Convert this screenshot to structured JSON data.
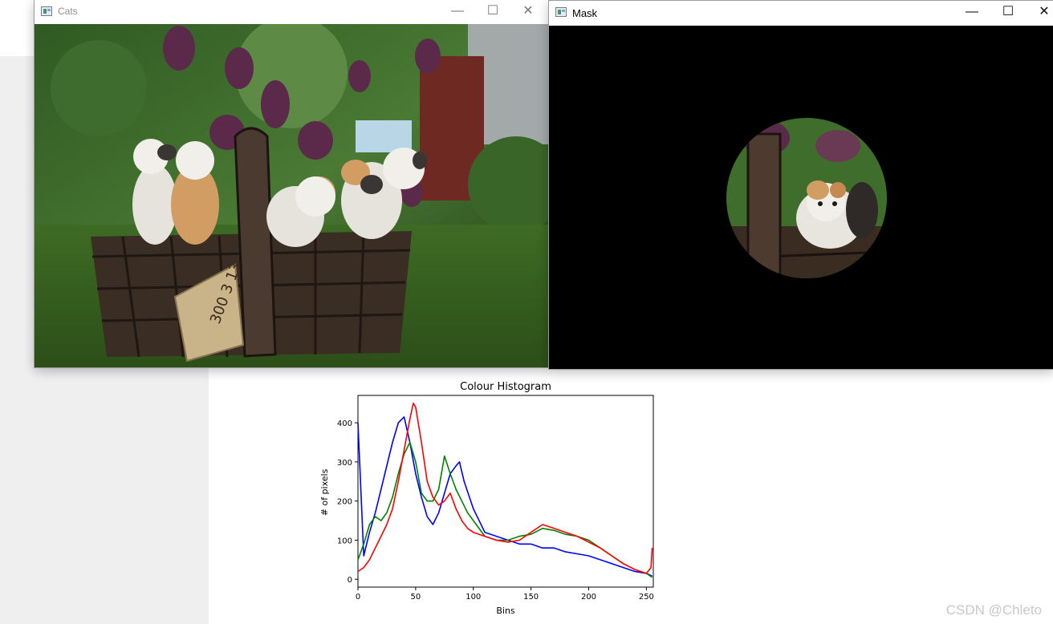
{
  "cats_window": {
    "title": "Cats",
    "controls": {
      "minimize": "—",
      "maximize": "☐",
      "close": "✕"
    },
    "tag_text": "300 3 13"
  },
  "mask_window": {
    "title": "Mask",
    "controls": {
      "minimize": "—",
      "maximize": "☐",
      "close": "✕"
    }
  },
  "watermark": "CSDN @Chleto",
  "colors": {
    "blue": "#0000ff",
    "green": "#008000",
    "red": "#ff0000",
    "mask_bg": "#000000"
  },
  "chart_data": {
    "type": "line",
    "title": "Colour Histogram",
    "xlabel": "Bins",
    "ylabel": "# of pixels",
    "xlim": [
      0,
      256
    ],
    "ylim": [
      -20,
      470
    ],
    "xticks": [
      "0",
      "50",
      "100",
      "150",
      "200",
      "250"
    ],
    "yticks": [
      "0",
      "100",
      "200",
      "300",
      "400"
    ],
    "grid": false,
    "series": [
      {
        "color": "blue",
        "x": [
          0,
          5,
          10,
          15,
          20,
          25,
          30,
          35,
          40,
          45,
          50,
          55,
          60,
          65,
          70,
          75,
          80,
          85,
          88,
          92,
          100,
          110,
          120,
          130,
          140,
          150,
          160,
          170,
          180,
          190,
          200,
          210,
          220,
          230,
          240,
          250,
          255
        ],
        "y": [
          400,
          60,
          120,
          170,
          230,
          290,
          350,
          400,
          415,
          350,
          270,
          210,
          160,
          140,
          170,
          220,
          270,
          290,
          300,
          250,
          180,
          120,
          110,
          100,
          90,
          90,
          80,
          80,
          70,
          65,
          60,
          50,
          40,
          30,
          20,
          15,
          8
        ]
      },
      {
        "color": "green",
        "x": [
          0,
          5,
          10,
          15,
          20,
          25,
          30,
          35,
          40,
          45,
          50,
          55,
          60,
          65,
          70,
          75,
          80,
          85,
          90,
          95,
          100,
          110,
          120,
          130,
          140,
          150,
          160,
          170,
          180,
          190,
          200,
          210,
          220,
          230,
          240,
          250,
          255
        ],
        "y": [
          50,
          90,
          140,
          160,
          150,
          170,
          210,
          270,
          320,
          350,
          300,
          220,
          200,
          200,
          230,
          315,
          270,
          230,
          200,
          170,
          150,
          110,
          100,
          100,
          110,
          115,
          130,
          125,
          115,
          110,
          100,
          80,
          60,
          40,
          25,
          15,
          5
        ]
      },
      {
        "color": "red",
        "x": [
          0,
          5,
          10,
          15,
          20,
          25,
          30,
          35,
          40,
          45,
          48,
          50,
          55,
          60,
          65,
          70,
          75,
          80,
          85,
          90,
          95,
          100,
          110,
          120,
          130,
          140,
          150,
          160,
          170,
          180,
          190,
          200,
          210,
          220,
          230,
          240,
          250,
          254,
          255
        ],
        "y": [
          20,
          30,
          50,
          80,
          110,
          140,
          180,
          250,
          330,
          410,
          450,
          440,
          350,
          250,
          210,
          190,
          200,
          220,
          180,
          150,
          130,
          120,
          110,
          100,
          95,
          100,
          120,
          140,
          130,
          120,
          110,
          95,
          80,
          60,
          40,
          25,
          15,
          30,
          80
        ]
      }
    ]
  }
}
